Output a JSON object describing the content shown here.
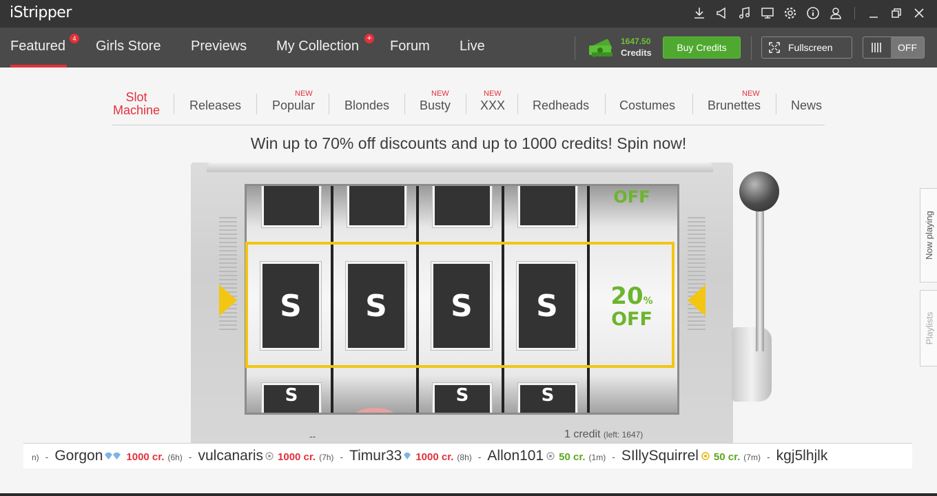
{
  "app": {
    "title": "iStripper"
  },
  "titlebar": {
    "icons": [
      "download-icon",
      "announce-icon",
      "music-icon",
      "monitor-icon",
      "settings-icon",
      "info-icon",
      "user-icon"
    ],
    "window_controls": [
      "minimize-icon",
      "restore-icon",
      "close-icon"
    ]
  },
  "nav": {
    "items": [
      {
        "label": "Featured",
        "badge": "4",
        "active": true
      },
      {
        "label": "Girls Store"
      },
      {
        "label": "Previews"
      },
      {
        "label": "My Collection",
        "badge": "+"
      },
      {
        "label": "Forum"
      },
      {
        "label": "Live"
      }
    ],
    "credits_amount": "1647.50",
    "credits_label": "Credits",
    "buy_label": "Buy Credits",
    "fullscreen_label": "Fullscreen",
    "toggle_label": "OFF"
  },
  "categories": [
    {
      "label": "Slot Machine",
      "line1": "Slot",
      "line2": "Machine",
      "active": true
    },
    {
      "label": "Releases"
    },
    {
      "label": "Popular",
      "new": "NEW"
    },
    {
      "label": "Blondes"
    },
    {
      "label": "Busty",
      "new": "NEW"
    },
    {
      "label": "XXX",
      "new": "NEW"
    },
    {
      "label": "Redheads"
    },
    {
      "label": "Costumes"
    },
    {
      "label": "Brunettes",
      "new": "NEW"
    },
    {
      "label": "News"
    }
  ],
  "promo_text": "Win up to 70% off discounts and up to 1000 credits! Spin now!",
  "slot": {
    "card_symbol": "S",
    "prize_percent": "20",
    "percent_sign": "%",
    "prize_off": "OFF",
    "top_off": "OFF",
    "dash": "--",
    "credit_cost": "1 credit",
    "credits_left": "(left: 1647)"
  },
  "side_tabs": {
    "now_playing": "Now playing",
    "playlists": "Playlists"
  },
  "ticker": [
    {
      "prefix": "n)",
      "user": "Gorgon",
      "icon": "diamond-icon",
      "amount": "1000 cr.",
      "time": "(6h)",
      "color": "red"
    },
    {
      "user": "vulcanaris",
      "icon": "coin-icon",
      "amount": "1000 cr.",
      "time": "(7h)",
      "color": "red"
    },
    {
      "user": "Timur33",
      "icon": "diamond-icon",
      "amount": "1000 cr.",
      "time": "(8h)",
      "color": "red"
    },
    {
      "user": "Allon101",
      "icon": "coin-icon",
      "amount": "50 cr.",
      "time": "(1m)",
      "color": "green"
    },
    {
      "user": "SIllySquirrel",
      "icon": "gold-coin-icon",
      "amount": "50 cr.",
      "time": "(7m)",
      "color": "green"
    },
    {
      "user": "kgj5lhjlk"
    }
  ],
  "colors": {
    "accent": "#e2313b",
    "green": "#4fa82f",
    "payline": "#f2c612",
    "prize": "#6cb52e"
  }
}
